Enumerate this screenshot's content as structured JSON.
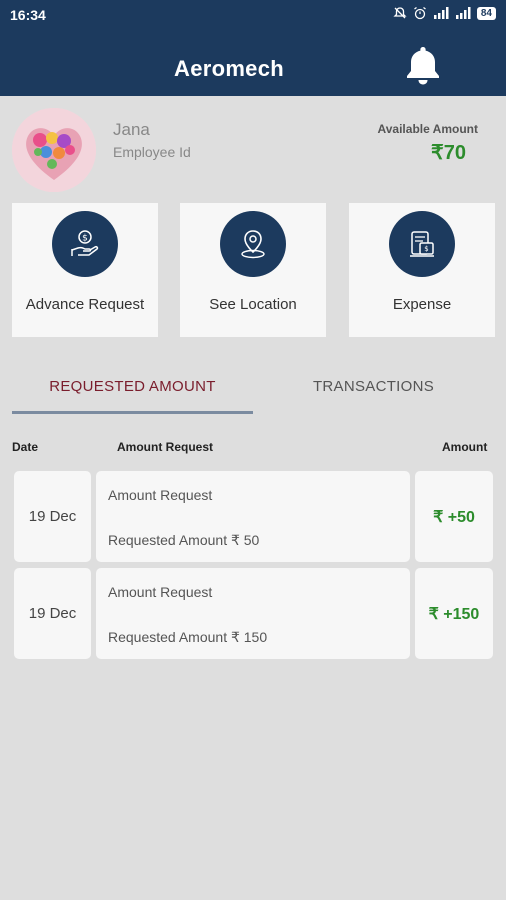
{
  "status_bar": {
    "time": "16:34",
    "battery": "84"
  },
  "header": {
    "title": "Aeromech"
  },
  "profile": {
    "name": "Jana",
    "employee_id_label": "Employee Id",
    "available_label": "Available Amount",
    "available_value": "₹70"
  },
  "actions": [
    {
      "label": "Advance Request"
    },
    {
      "label": "See Location"
    },
    {
      "label": "Expense"
    }
  ],
  "tabs": [
    {
      "label": "REQUESTED AMOUNT",
      "active": true
    },
    {
      "label": "TRANSACTIONS",
      "active": false
    }
  ],
  "table": {
    "headers": {
      "date": "Date",
      "request": "Amount Request",
      "amount": "Amount"
    },
    "rows": [
      {
        "date": "19 Dec",
        "title": "Amount Request",
        "detail": "Requested Amount ₹ 50",
        "amount": "₹ +50"
      },
      {
        "date": "19 Dec",
        "title": "Amount Request",
        "detail": "Requested Amount ₹ 150",
        "amount": "₹ +150"
      }
    ]
  },
  "colors": {
    "primary": "#1c3a5e",
    "accent_red": "#7a1d2c",
    "positive": "#2c8c2c",
    "background": "#dedede"
  }
}
